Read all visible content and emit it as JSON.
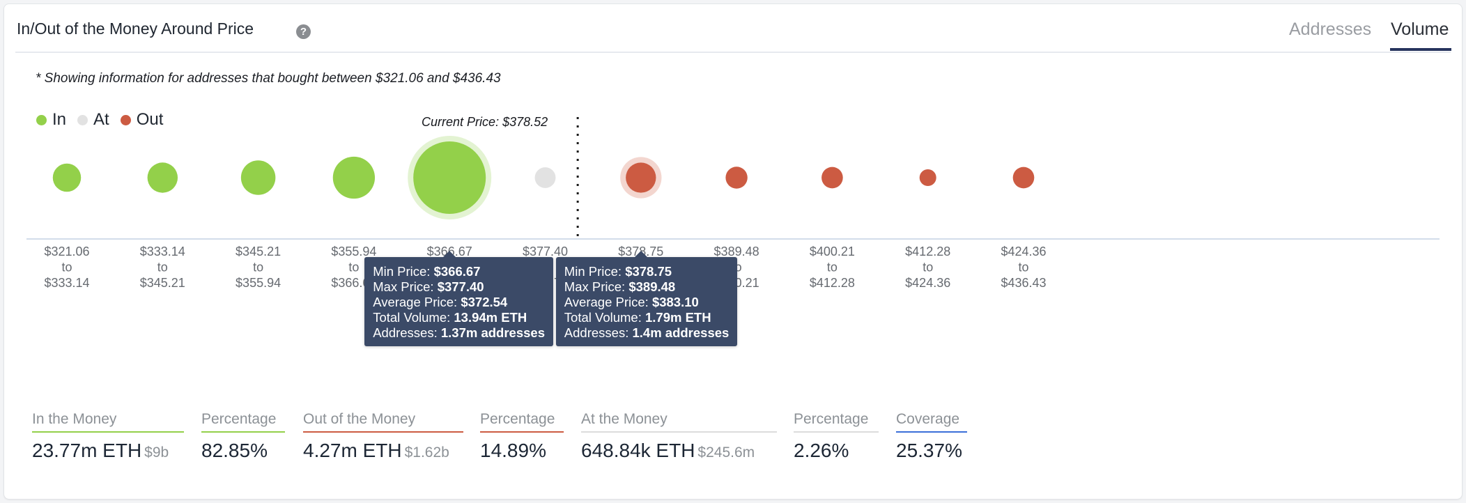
{
  "header": {
    "title": "In/Out of the Money Around Price",
    "help_icon": "question-circle-icon",
    "tabs": [
      {
        "label": "Addresses",
        "active": false
      },
      {
        "label": "Volume",
        "active": true
      }
    ]
  },
  "note": "* Showing information for addresses that bought between $321.06 and $436.43",
  "legend": [
    {
      "label": "In",
      "color": "#93d04a"
    },
    {
      "label": "At",
      "color": "#e2e2e2"
    },
    {
      "label": "Out",
      "color": "#cc5b42"
    }
  ],
  "colors": {
    "in": "#93d04a",
    "at": "#e2e2e2",
    "out": "#cc5b42",
    "tooltip_bg": "#3b4a67",
    "in_halo": "#e3f3d2",
    "out_halo": "#f3d6cf"
  },
  "chart_data": {
    "type": "scatter",
    "subtype": "bubble",
    "title": "In/Out of the Money Around Price",
    "current_price_label": "Current Price: $378.52",
    "current_price": 378.52,
    "categories": [
      {
        "from": "$321.06",
        "to": "$333.14"
      },
      {
        "from": "$333.14",
        "to": "$345.21"
      },
      {
        "from": "$345.21",
        "to": "$355.94"
      },
      {
        "from": "$355.94",
        "to": "$366.67"
      },
      {
        "from": "$366.67",
        "to": "$377.40"
      },
      {
        "from": "$377.40",
        "to": "$378.75"
      },
      {
        "from": "$378.75",
        "to": "$389.48"
      },
      {
        "from": "$389.48",
        "to": "$400.21"
      },
      {
        "from": "$400.21",
        "to": "$412.28"
      },
      {
        "from": "$412.28",
        "to": "$424.36"
      },
      {
        "from": "$424.36",
        "to": "$436.43"
      }
    ],
    "tick_joiner": "to",
    "status": [
      "in",
      "in",
      "in",
      "in",
      "in",
      "at",
      "out",
      "out",
      "out",
      "out",
      "out"
    ],
    "volume_eth_m": [
      1.5,
      1.8,
      2.5,
      4.03,
      13.94,
      0.65,
      1.79,
      0.75,
      0.7,
      0.33,
      0.7
    ],
    "highlighted": [
      4,
      6
    ],
    "current_price_after_index": 5,
    "legend_position": "top-left",
    "grid": false
  },
  "tooltips": [
    {
      "index": 4,
      "rows": [
        {
          "label": "Min Price: ",
          "value": "$366.67"
        },
        {
          "label": "Max Price: ",
          "value": "$377.40"
        },
        {
          "label": "Average Price: ",
          "value": "$372.54"
        },
        {
          "label": "Total Volume: ",
          "value": "13.94m ETH"
        },
        {
          "label": "Addresses: ",
          "value": "1.37m addresses"
        }
      ]
    },
    {
      "index": 6,
      "rows": [
        {
          "label": "Min Price: ",
          "value": "$378.75"
        },
        {
          "label": "Max Price: ",
          "value": "$389.48"
        },
        {
          "label": "Average Price: ",
          "value": "$383.10"
        },
        {
          "label": "Total Volume: ",
          "value": "1.79m ETH"
        },
        {
          "label": "Addresses: ",
          "value": "1.4m addresses"
        }
      ]
    }
  ],
  "stats": [
    {
      "label": "In the Money",
      "value": "23.77m ETH",
      "sub": "$9b",
      "color": "#93d04a"
    },
    {
      "label": "Percentage",
      "value": "82.85%",
      "sub": "",
      "color": "#93d04a"
    },
    {
      "label": "Out of the Money",
      "value": "4.27m ETH",
      "sub": "$1.62b",
      "color": "#cc5b42"
    },
    {
      "label": "Percentage",
      "value": "14.89%",
      "sub": "",
      "color": "#cc5b42"
    },
    {
      "label": "At the Money",
      "value": "648.84k ETH",
      "sub": "$245.6m",
      "color": "#dcdcdc"
    },
    {
      "label": "Percentage",
      "value": "2.26%",
      "sub": "",
      "color": "#dcdcdc"
    },
    {
      "label": "Coverage",
      "value": "25.37%",
      "sub": "",
      "color": "#3b6fd8"
    }
  ]
}
